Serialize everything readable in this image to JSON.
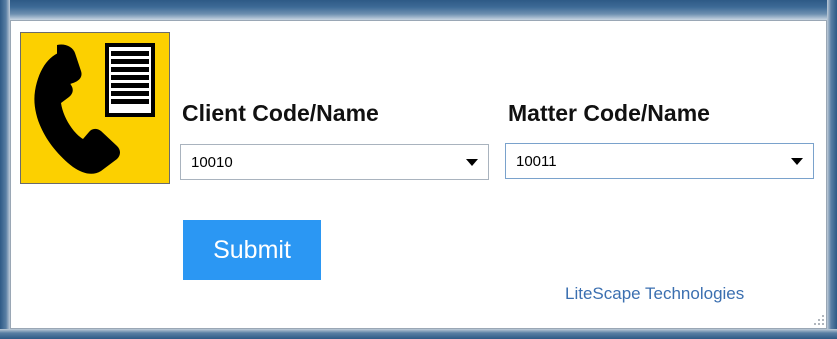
{
  "client": {
    "label": "Client Code/Name",
    "selected_value": "10010"
  },
  "matter": {
    "label": "Matter Code/Name",
    "selected_value": "10011"
  },
  "actions": {
    "submit_label": "Submit"
  },
  "footer": {
    "company_link": "LiteScape Technologies"
  },
  "icons": {
    "logo": "phone-with-list-icon",
    "dropdown": "chevron-down-icon",
    "resize": "resize-grip-icon"
  },
  "colors": {
    "logo_background": "#fcd000",
    "submit_background": "#2b97f3",
    "link": "#3b6fb0",
    "frame": "#2e5a86"
  }
}
